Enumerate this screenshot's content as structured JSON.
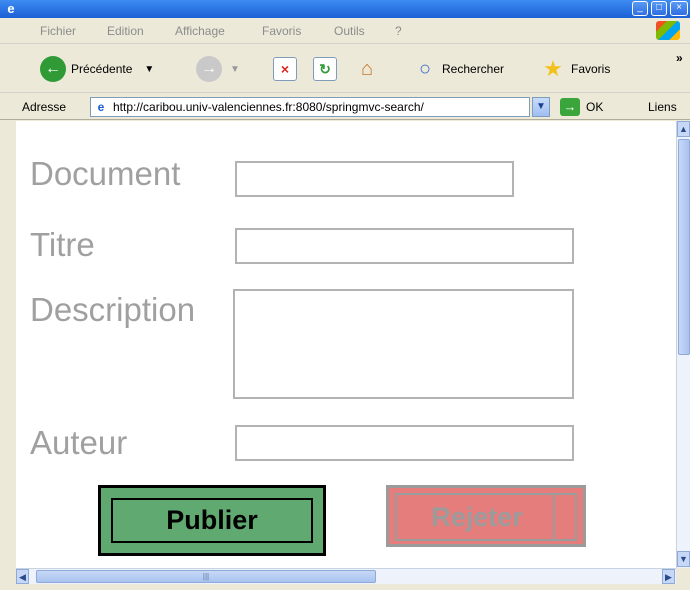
{
  "menu": {
    "items": [
      "Fichier",
      "Edition",
      "Affichage",
      "Favoris",
      "Outils",
      "?"
    ]
  },
  "toolbar": {
    "back_label": "Précédente",
    "search_label": "Rechercher",
    "favorites_label": "Favoris",
    "more_label": "»"
  },
  "address": {
    "label": "Adresse",
    "url": "http://caribou.univ-valenciennes.fr:8080/springmvc-search/",
    "go_label": "OK",
    "links_label": "Liens"
  },
  "form": {
    "document_label": "Document",
    "title_label": "Titre",
    "description_label": "Description",
    "author_label": "Auteur",
    "publish_label": "Publier",
    "reject_label": "Rejeter"
  },
  "colors": {
    "publish_button": "#5fa86f",
    "reject_button": "#e57d7d",
    "label_text": "#a0a0a0"
  }
}
